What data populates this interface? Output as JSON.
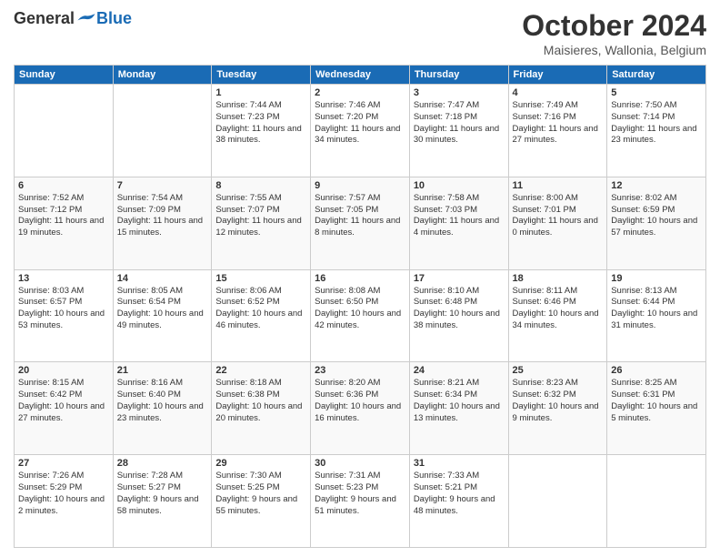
{
  "logo": {
    "general": "General",
    "blue": "Blue"
  },
  "title": "October 2024",
  "location": "Maisieres, Wallonia, Belgium",
  "days_of_week": [
    "Sunday",
    "Monday",
    "Tuesday",
    "Wednesday",
    "Thursday",
    "Friday",
    "Saturday"
  ],
  "weeks": [
    [
      {
        "day": "",
        "sunrise": "",
        "sunset": "",
        "daylight": ""
      },
      {
        "day": "",
        "sunrise": "",
        "sunset": "",
        "daylight": ""
      },
      {
        "day": "1",
        "sunrise": "Sunrise: 7:44 AM",
        "sunset": "Sunset: 7:23 PM",
        "daylight": "Daylight: 11 hours and 38 minutes."
      },
      {
        "day": "2",
        "sunrise": "Sunrise: 7:46 AM",
        "sunset": "Sunset: 7:20 PM",
        "daylight": "Daylight: 11 hours and 34 minutes."
      },
      {
        "day": "3",
        "sunrise": "Sunrise: 7:47 AM",
        "sunset": "Sunset: 7:18 PM",
        "daylight": "Daylight: 11 hours and 30 minutes."
      },
      {
        "day": "4",
        "sunrise": "Sunrise: 7:49 AM",
        "sunset": "Sunset: 7:16 PM",
        "daylight": "Daylight: 11 hours and 27 minutes."
      },
      {
        "day": "5",
        "sunrise": "Sunrise: 7:50 AM",
        "sunset": "Sunset: 7:14 PM",
        "daylight": "Daylight: 11 hours and 23 minutes."
      }
    ],
    [
      {
        "day": "6",
        "sunrise": "Sunrise: 7:52 AM",
        "sunset": "Sunset: 7:12 PM",
        "daylight": "Daylight: 11 hours and 19 minutes."
      },
      {
        "day": "7",
        "sunrise": "Sunrise: 7:54 AM",
        "sunset": "Sunset: 7:09 PM",
        "daylight": "Daylight: 11 hours and 15 minutes."
      },
      {
        "day": "8",
        "sunrise": "Sunrise: 7:55 AM",
        "sunset": "Sunset: 7:07 PM",
        "daylight": "Daylight: 11 hours and 12 minutes."
      },
      {
        "day": "9",
        "sunrise": "Sunrise: 7:57 AM",
        "sunset": "Sunset: 7:05 PM",
        "daylight": "Daylight: 11 hours and 8 minutes."
      },
      {
        "day": "10",
        "sunrise": "Sunrise: 7:58 AM",
        "sunset": "Sunset: 7:03 PM",
        "daylight": "Daylight: 11 hours and 4 minutes."
      },
      {
        "day": "11",
        "sunrise": "Sunrise: 8:00 AM",
        "sunset": "Sunset: 7:01 PM",
        "daylight": "Daylight: 11 hours and 0 minutes."
      },
      {
        "day": "12",
        "sunrise": "Sunrise: 8:02 AM",
        "sunset": "Sunset: 6:59 PM",
        "daylight": "Daylight: 10 hours and 57 minutes."
      }
    ],
    [
      {
        "day": "13",
        "sunrise": "Sunrise: 8:03 AM",
        "sunset": "Sunset: 6:57 PM",
        "daylight": "Daylight: 10 hours and 53 minutes."
      },
      {
        "day": "14",
        "sunrise": "Sunrise: 8:05 AM",
        "sunset": "Sunset: 6:54 PM",
        "daylight": "Daylight: 10 hours and 49 minutes."
      },
      {
        "day": "15",
        "sunrise": "Sunrise: 8:06 AM",
        "sunset": "Sunset: 6:52 PM",
        "daylight": "Daylight: 10 hours and 46 minutes."
      },
      {
        "day": "16",
        "sunrise": "Sunrise: 8:08 AM",
        "sunset": "Sunset: 6:50 PM",
        "daylight": "Daylight: 10 hours and 42 minutes."
      },
      {
        "day": "17",
        "sunrise": "Sunrise: 8:10 AM",
        "sunset": "Sunset: 6:48 PM",
        "daylight": "Daylight: 10 hours and 38 minutes."
      },
      {
        "day": "18",
        "sunrise": "Sunrise: 8:11 AM",
        "sunset": "Sunset: 6:46 PM",
        "daylight": "Daylight: 10 hours and 34 minutes."
      },
      {
        "day": "19",
        "sunrise": "Sunrise: 8:13 AM",
        "sunset": "Sunset: 6:44 PM",
        "daylight": "Daylight: 10 hours and 31 minutes."
      }
    ],
    [
      {
        "day": "20",
        "sunrise": "Sunrise: 8:15 AM",
        "sunset": "Sunset: 6:42 PM",
        "daylight": "Daylight: 10 hours and 27 minutes."
      },
      {
        "day": "21",
        "sunrise": "Sunrise: 8:16 AM",
        "sunset": "Sunset: 6:40 PM",
        "daylight": "Daylight: 10 hours and 23 minutes."
      },
      {
        "day": "22",
        "sunrise": "Sunrise: 8:18 AM",
        "sunset": "Sunset: 6:38 PM",
        "daylight": "Daylight: 10 hours and 20 minutes."
      },
      {
        "day": "23",
        "sunrise": "Sunrise: 8:20 AM",
        "sunset": "Sunset: 6:36 PM",
        "daylight": "Daylight: 10 hours and 16 minutes."
      },
      {
        "day": "24",
        "sunrise": "Sunrise: 8:21 AM",
        "sunset": "Sunset: 6:34 PM",
        "daylight": "Daylight: 10 hours and 13 minutes."
      },
      {
        "day": "25",
        "sunrise": "Sunrise: 8:23 AM",
        "sunset": "Sunset: 6:32 PM",
        "daylight": "Daylight: 10 hours and 9 minutes."
      },
      {
        "day": "26",
        "sunrise": "Sunrise: 8:25 AM",
        "sunset": "Sunset: 6:31 PM",
        "daylight": "Daylight: 10 hours and 5 minutes."
      }
    ],
    [
      {
        "day": "27",
        "sunrise": "Sunrise: 7:26 AM",
        "sunset": "Sunset: 5:29 PM",
        "daylight": "Daylight: 10 hours and 2 minutes."
      },
      {
        "day": "28",
        "sunrise": "Sunrise: 7:28 AM",
        "sunset": "Sunset: 5:27 PM",
        "daylight": "Daylight: 9 hours and 58 minutes."
      },
      {
        "day": "29",
        "sunrise": "Sunrise: 7:30 AM",
        "sunset": "Sunset: 5:25 PM",
        "daylight": "Daylight: 9 hours and 55 minutes."
      },
      {
        "day": "30",
        "sunrise": "Sunrise: 7:31 AM",
        "sunset": "Sunset: 5:23 PM",
        "daylight": "Daylight: 9 hours and 51 minutes."
      },
      {
        "day": "31",
        "sunrise": "Sunrise: 7:33 AM",
        "sunset": "Sunset: 5:21 PM",
        "daylight": "Daylight: 9 hours and 48 minutes."
      },
      {
        "day": "",
        "sunrise": "",
        "sunset": "",
        "daylight": ""
      },
      {
        "day": "",
        "sunrise": "",
        "sunset": "",
        "daylight": ""
      }
    ]
  ],
  "colors": {
    "header_bg": "#1a6bb5",
    "header_text": "#ffffff",
    "accent": "#1a6bb5"
  }
}
